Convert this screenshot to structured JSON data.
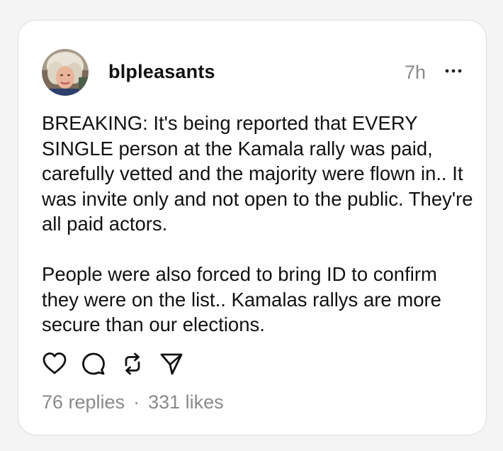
{
  "post": {
    "username": "blpleasants",
    "timestamp": "7h",
    "more_icon": "ellipsis-icon",
    "paragraphs": [
      "BREAKING:  It's being reported that EVERY SINGLE person at the Kamala rally was paid, carefully vetted and the majority were flown in.. It was invite only and not open to the public. They're all paid actors.",
      "People were also forced to bring ID to confirm they were on the list.. Kamalas rallys are more secure than our elections."
    ],
    "actions": {
      "like_icon": "heart-icon",
      "reply_icon": "comment-icon",
      "repost_icon": "repost-icon",
      "share_icon": "send-icon"
    },
    "stats": {
      "replies": "76 replies",
      "separator": "·",
      "likes": "331 likes"
    }
  },
  "colors": {
    "text": "#111111",
    "muted": "#8a8a8a",
    "border": "#dcdcdc",
    "background": "#f4f4f4"
  }
}
